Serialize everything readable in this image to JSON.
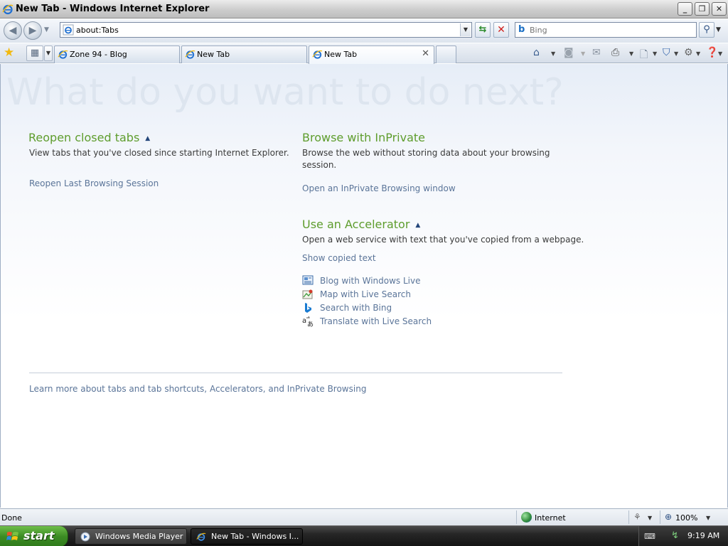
{
  "window": {
    "title": "New Tab - Windows Internet Explorer",
    "minimize": "_",
    "maximize": "❐",
    "close": "✕"
  },
  "address": {
    "url": "about:Tabs",
    "search_placeholder": "Bing"
  },
  "tabs": [
    {
      "label": "Zone 94 - Blog",
      "active": false
    },
    {
      "label": "New Tab",
      "active": false
    },
    {
      "label": "New Tab",
      "active": true
    }
  ],
  "content": {
    "heading": "What do you want to do next?",
    "reopen": {
      "title": "Reopen closed tabs",
      "desc": "View tabs that you've closed since starting Internet Explorer.",
      "link": "Reopen Last Browsing Session"
    },
    "inprivate": {
      "title": "Browse with InPrivate",
      "desc": "Browse the web without storing data about your browsing session.",
      "link": "Open an InPrivate Browsing window"
    },
    "accelerator": {
      "title": "Use an Accelerator",
      "desc": "Open a web service with text that you've copied from a webpage.",
      "show_link": "Show copied text",
      "items": [
        {
          "label": "Blog with Windows Live",
          "icon": "blog-icon"
        },
        {
          "label": "Map with Live Search",
          "icon": "map-icon"
        },
        {
          "label": "Search with Bing",
          "icon": "bing-icon"
        },
        {
          "label": "Translate with Live Search",
          "icon": "translate-icon"
        }
      ]
    },
    "footer_link": "Learn more about tabs and tab shortcuts, Accelerators, and InPrivate Browsing"
  },
  "status": {
    "text": "Done",
    "zone": "Internet",
    "zoom": "100%"
  },
  "taskbar": {
    "start": "start",
    "tasks": [
      {
        "label": "Windows Media Player",
        "active": false
      },
      {
        "label": "New Tab - Windows I...",
        "active": true
      }
    ],
    "clock": "9:19 AM"
  },
  "colors": {
    "section_title": "#5e9d2d",
    "link": "#5b7599",
    "heading_watermark": "#dde5ef"
  }
}
